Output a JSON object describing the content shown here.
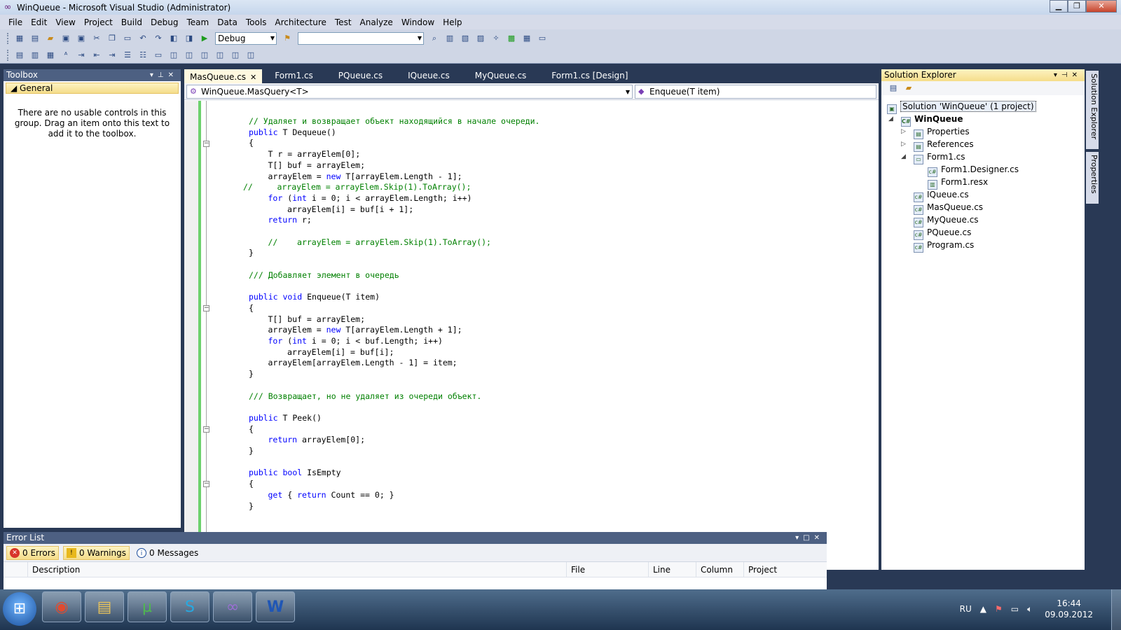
{
  "window": {
    "title": "WinQueue - Microsoft Visual Studio (Administrator)"
  },
  "menu": [
    "File",
    "Edit",
    "View",
    "Project",
    "Build",
    "Debug",
    "Team",
    "Data",
    "Tools",
    "Architecture",
    "Test",
    "Analyze",
    "Window",
    "Help"
  ],
  "toolbar": {
    "config": "Debug",
    "platform": ""
  },
  "toolbox": {
    "title": "Toolbox",
    "group": "General",
    "empty_text": "There are no usable controls in this group. Drag an item onto this text to add it to the toolbox."
  },
  "tabs": [
    {
      "label": "MasQueue.cs",
      "active": true
    },
    {
      "label": "Form1.cs"
    },
    {
      "label": "PQueue.cs"
    },
    {
      "label": "IQueue.cs"
    },
    {
      "label": "MyQueue.cs"
    },
    {
      "label": "Form1.cs [Design]"
    }
  ],
  "navbar": {
    "type": "WinQueue.MasQuery<T>",
    "member": "Enqueue(T item)"
  },
  "code": [
    {
      "text": "// Удаляет и возвращает объект находящийся в начале очереди.",
      "indent": 0,
      "kind": "comment"
    },
    {
      "text": "public T Dequeue()",
      "indent": 0,
      "kind": "decl",
      "kw": "public",
      "rest": " T Dequeue()"
    },
    {
      "text": "{",
      "indent": 0
    },
    {
      "text": "T r = arrayElem[0];",
      "indent": 1
    },
    {
      "text": "T[] buf = arrayElem;",
      "indent": 1
    },
    {
      "text": "arrayElem = new T[arrayElem.Length - 1];",
      "indent": 1
    },
    {
      "text": "//     arrayElem = arrayElem.Skip(1).ToArray();",
      "indent": 0,
      "kind": "comment_outdent"
    },
    {
      "text": "for (int i = 0; i < arrayElem.Length; i++)",
      "indent": 1
    },
    {
      "text": "arrayElem[i] = buf[i + 1];",
      "indent": 2
    },
    {
      "text": "return r;",
      "indent": 1
    },
    {
      "text": "",
      "indent": 0
    },
    {
      "text": "//    arrayElem = arrayElem.Skip(1).ToArray();",
      "indent": 1,
      "kind": "comment"
    },
    {
      "text": "}",
      "indent": 0
    },
    {
      "text": "",
      "indent": 0
    },
    {
      "text": "/// Добавляет элемент в очередь",
      "indent": 0,
      "kind": "comment"
    },
    {
      "text": "",
      "indent": 0
    },
    {
      "text": "public void Enqueue(T item)",
      "indent": 0
    },
    {
      "text": "{",
      "indent": 0
    },
    {
      "text": "T[] buf = arrayElem;",
      "indent": 1
    },
    {
      "text": "arrayElem = new T[arrayElem.Length + 1];",
      "indent": 1
    },
    {
      "text": "for (int i = 0; i < buf.Length; i++)",
      "indent": 1
    },
    {
      "text": "arrayElem[i] = buf[i];",
      "indent": 2
    },
    {
      "text": "arrayElem[arrayElem.Length - 1] = item;",
      "indent": 1
    },
    {
      "text": "}",
      "indent": 0
    },
    {
      "text": "",
      "indent": 0
    },
    {
      "text": "/// Возвращает, но не удаляет из очереди объект.",
      "indent": 0,
      "kind": "comment"
    },
    {
      "text": "",
      "indent": 0
    },
    {
      "text": "public T Peek()",
      "indent": 0
    },
    {
      "text": "{",
      "indent": 0
    },
    {
      "text": "return arrayElem[0];",
      "indent": 1
    },
    {
      "text": "}",
      "indent": 0
    },
    {
      "text": "",
      "indent": 0
    },
    {
      "text": "public bool IsEmpty",
      "indent": 0
    },
    {
      "text": "{",
      "indent": 0
    },
    {
      "text": "get { return Count == 0; }",
      "indent": 1
    },
    {
      "text": "}",
      "indent": 0
    }
  ],
  "solution": {
    "title": "Solution Explorer",
    "root": "Solution 'WinQueue' (1 project)",
    "project": "WinQueue",
    "items": [
      "Properties",
      "References",
      "Form1.cs",
      "Form1.Designer.cs",
      "Form1.resx",
      "IQueue.cs",
      "MasQueue.cs",
      "MyQueue.cs",
      "PQueue.cs",
      "Program.cs"
    ]
  },
  "side_tabs": [
    "Solution Explorer",
    "Properties"
  ],
  "errorlist": {
    "title": "Error List",
    "errors": "0 Errors",
    "warnings": "0 Warnings",
    "messages": "0 Messages",
    "columns": [
      "Description",
      "File",
      "Line",
      "Column",
      "Project"
    ]
  },
  "tray": {
    "lang": "RU",
    "time": "16:44",
    "date": "09.09.2012"
  },
  "colors": {
    "chrome": "#293955",
    "keyword": "#0000ff",
    "comment": "#008000",
    "active_tab": "#fff9e0"
  }
}
